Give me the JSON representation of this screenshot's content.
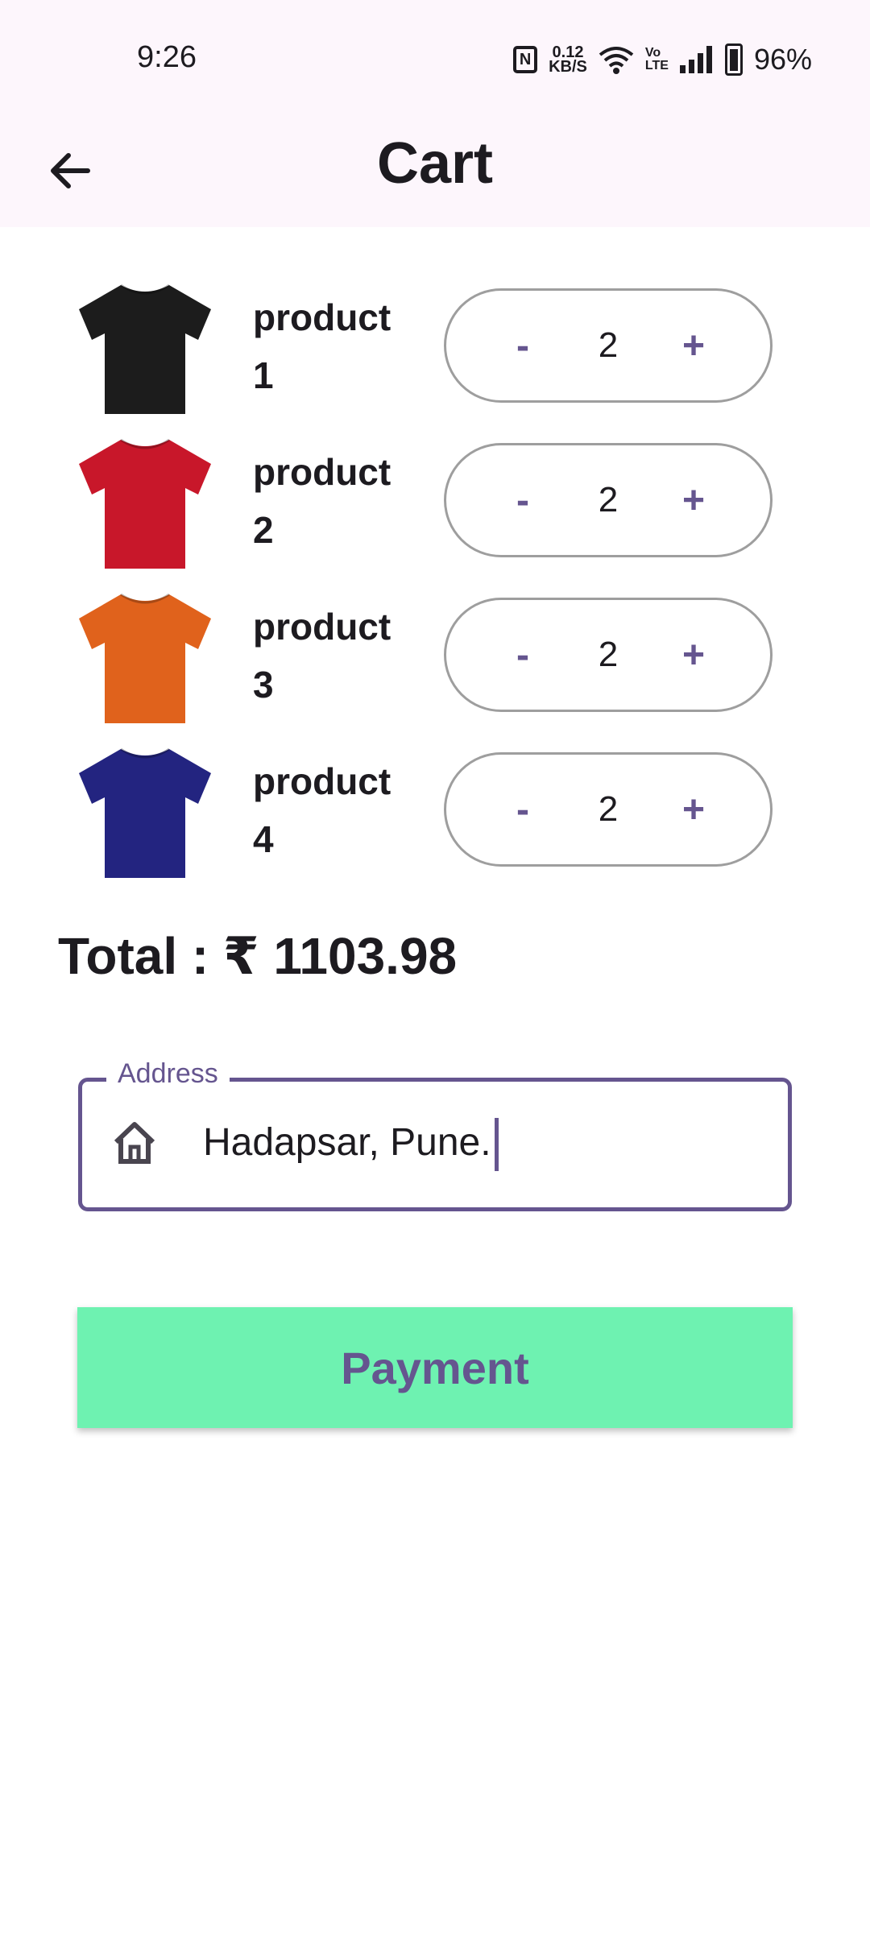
{
  "status": {
    "time": "9:26",
    "net_speed_top": "0.12",
    "net_speed_unit": "KB/S",
    "volte_top": "Vo",
    "volte_bottom": "LTE",
    "battery": "96%"
  },
  "app_bar": {
    "title": "Cart",
    "back_icon": "arrow-left-icon"
  },
  "cart": {
    "items": [
      {
        "name": "product 1",
        "shirt_color": "#1c1c1c",
        "quantity": "2",
        "minus": "-",
        "plus": "+"
      },
      {
        "name": "product 2",
        "shirt_color": "#c8172a",
        "quantity": "2",
        "minus": "-",
        "plus": "+"
      },
      {
        "name": "product 3",
        "shirt_color": "#e0621c",
        "quantity": "2",
        "minus": "-",
        "plus": "+"
      },
      {
        "name": "product 4",
        "shirt_color": "#232480",
        "quantity": "2",
        "minus": "-",
        "plus": "+"
      }
    ]
  },
  "total": {
    "text": "Total : ₹ 1103.98"
  },
  "address": {
    "label": "Address",
    "value": "Hadapsar, Pune.",
    "icon": "home-icon"
  },
  "payment": {
    "label": "Payment"
  },
  "colors": {
    "accent": "#65558f",
    "button_bg": "#6ef2b1",
    "appbar_bg": "#fdf6fc"
  }
}
